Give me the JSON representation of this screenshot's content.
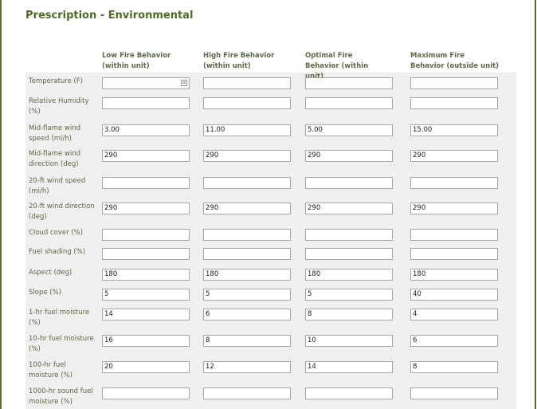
{
  "title": "Prescription - Environmental",
  "columns": [
    "Low Fire Behavior (within unit)",
    "High Fire Behavior (within unit)",
    "Optimal Fire Behavior (within unit)",
    "Maximum Fire Behavior (outside unit)"
  ],
  "rows": [
    {
      "label": "Temperature (F)",
      "values": [
        "",
        "",
        "",
        ""
      ]
    },
    {
      "label": "Relative Humidity (%)",
      "values": [
        "",
        "",
        "",
        ""
      ]
    },
    {
      "label": "Mid-flame wind speed (mi/h)",
      "values": [
        "3.00",
        "11.00",
        "5.00",
        "15.00"
      ]
    },
    {
      "label": "Mid-flame wind direction (deg)",
      "values": [
        "290",
        "290",
        "290",
        "290"
      ]
    },
    {
      "label": "20-ft wind speed (mi/h)",
      "values": [
        "",
        "",
        "",
        ""
      ]
    },
    {
      "label": "20-ft wind direction (deg)",
      "values": [
        "290",
        "290",
        "290",
        "290"
      ]
    },
    {
      "label": "Cloud cover (%)",
      "values": [
        "",
        "",
        "",
        ""
      ]
    },
    {
      "label": "Fuel shading (%)",
      "values": [
        "",
        "",
        "",
        ""
      ]
    },
    {
      "label": "Aspect (deg)",
      "values": [
        "180",
        "180",
        "180",
        "180"
      ]
    },
    {
      "label": "Slope (%)",
      "values": [
        "5",
        "5",
        "5",
        "40"
      ]
    },
    {
      "label": "1-hr fuel moisture (%)",
      "values": [
        "14",
        "6",
        "8",
        "4"
      ]
    },
    {
      "label": "10-hr fuel moisture (%)",
      "values": [
        "16",
        "8",
        "10",
        "6"
      ]
    },
    {
      "label": "100-hr fuel moisture (%)",
      "values": [
        "20",
        "12",
        "14",
        "8"
      ]
    },
    {
      "label": "1000-hr sound fuel moisture (%)",
      "values": [
        "",
        "",
        "",
        ""
      ]
    }
  ]
}
